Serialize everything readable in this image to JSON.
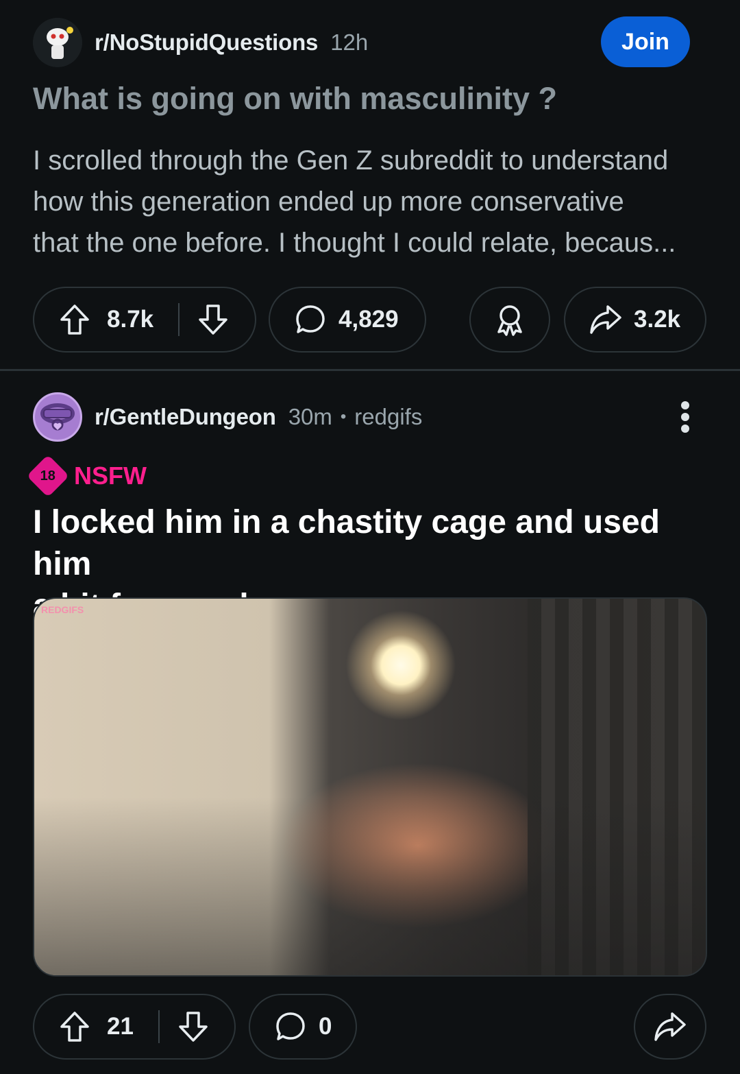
{
  "post1": {
    "subreddit": "r/NoStupidQuestions",
    "age": "12h",
    "join_label": "Join",
    "title": "What is going on with masculinity ?",
    "body_lines": [
      "I scrolled through the Gen Z subreddit to understand",
      "how this generation ended up more conservative",
      "that the one before. I thought I could relate, becaus..."
    ],
    "upvotes": "8.7k",
    "comments": "4,829",
    "shares": "3.2k"
  },
  "post2": {
    "subreddit": "r/GentleDungeon",
    "age": "30m",
    "separator": "•",
    "source": "redgifs",
    "nsfw_badge": "18",
    "nsfw_label": "NSFW",
    "title_lines": [
      "I locked him in a chastity cage and used him",
      "a bit for my pleasure"
    ],
    "media_watermark": "REDGIFS",
    "upvotes": "21",
    "comments": "0"
  },
  "colors": {
    "background": "#0e1113",
    "join_button": "#0a5fd6",
    "nsfw": "#ff1f8e",
    "pill_border": "#2c3438"
  },
  "icons": [
    "upvote-icon",
    "downvote-icon",
    "comment-icon",
    "award-icon",
    "share-icon",
    "more-options-icon"
  ]
}
